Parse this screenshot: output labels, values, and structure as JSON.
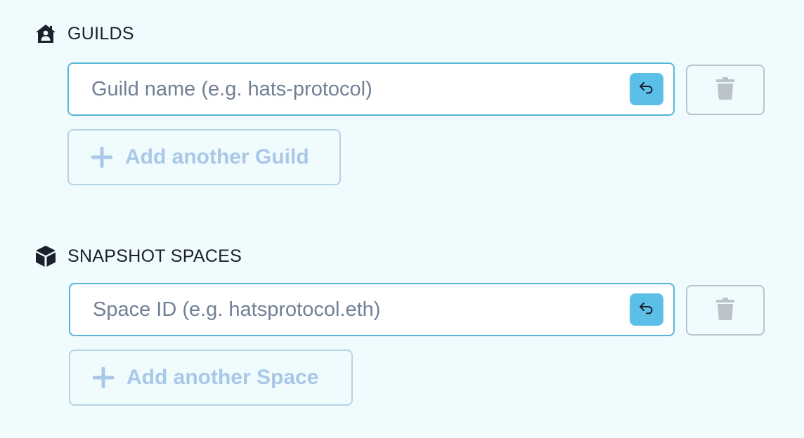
{
  "guilds": {
    "title": "GUILDS",
    "icon": "house-user-icon",
    "input": {
      "placeholder": "Guild name (e.g. hats-protocol)",
      "value": ""
    },
    "add_label": "Add another Guild"
  },
  "spaces": {
    "title": "SNAPSHOT SPACES",
    "icon": "cube-icon",
    "input": {
      "placeholder": "Space ID (e.g. hatsprotocol.eth)",
      "value": ""
    },
    "add_label": "Add another Space"
  },
  "colors": {
    "background": "#f0fbfd",
    "input_border": "#5bb5d6",
    "reset_button": "#5bbfe8",
    "trash_icon": "#b9c3c9",
    "add_button_text": "#a9c8e8"
  }
}
